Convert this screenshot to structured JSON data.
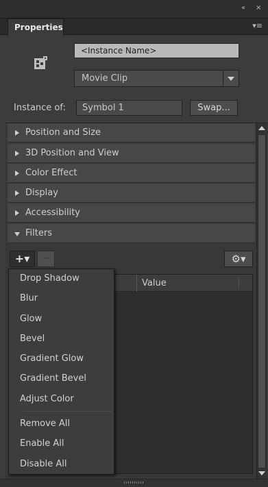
{
  "panel": {
    "tab_label": "Properties",
    "window_controls": {
      "collapse": "«",
      "close": "×"
    },
    "menu_icon": "≡"
  },
  "instance": {
    "name_placeholder": "<Instance Name>",
    "type_value": "Movie Clip",
    "instance_of_label": "Instance of:",
    "symbol_value": "Symbol 1",
    "swap_label": "Swap..."
  },
  "sections": [
    {
      "label": "Position and Size",
      "expanded": false
    },
    {
      "label": "3D Position and View",
      "expanded": false
    },
    {
      "label": "Color Effect",
      "expanded": false
    },
    {
      "label": "Display",
      "expanded": false
    },
    {
      "label": "Accessibility",
      "expanded": false
    },
    {
      "label": "Filters",
      "expanded": true
    }
  ],
  "filters": {
    "add_label": "+▾",
    "remove_label": "−",
    "options_label": "⚙▾",
    "columns": {
      "value": "Value"
    },
    "menu_items": [
      "Drop Shadow",
      "Blur",
      "Glow",
      "Bevel",
      "Gradient Glow",
      "Gradient Bevel",
      "Adjust Color",
      "Remove All",
      "Enable All",
      "Disable All"
    ]
  },
  "icons": {
    "symbol": "movie-clip-icon",
    "add": "plus-icon",
    "remove": "minus-icon",
    "options": "gear-icon",
    "panel_menu": "panel-menu-icon"
  },
  "colors": {
    "panel_bg": "#3c3c3c",
    "section_bg": "#474747",
    "instance_field_bg": "#b9b9b9"
  }
}
